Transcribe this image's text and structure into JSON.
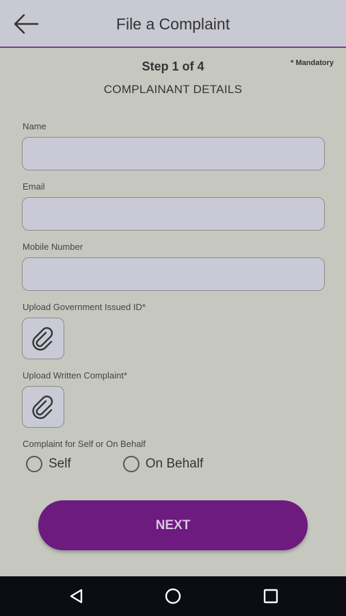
{
  "appbar": {
    "title": "File a Complaint",
    "back_icon": "arrow-left-icon"
  },
  "header": {
    "step": "Step 1 of 4",
    "mandatory_note": "* Mandatory",
    "section_title": "COMPLAINANT DETAILS"
  },
  "form": {
    "name": {
      "label": "Name",
      "value": ""
    },
    "email": {
      "label": "Email",
      "value": ""
    },
    "mobile": {
      "label": "Mobile Number",
      "value": ""
    },
    "upload_id": {
      "label": "Upload Government Issued ID*",
      "icon": "paperclip-icon"
    },
    "upload_complaint": {
      "label": "Upload Written Complaint*",
      "icon": "paperclip-icon"
    },
    "complaint_for": {
      "label": "Complaint for Self or On Behalf",
      "options": [
        "Self",
        "On Behalf"
      ],
      "selected": null
    }
  },
  "next_button": {
    "label": "NEXT"
  },
  "colors": {
    "primary": "#6d1b7e",
    "background": "#c6c8c0",
    "field": "#c9cad6"
  },
  "system_nav": {
    "back": "triangle-back-icon",
    "home": "circle-home-icon",
    "recents": "square-recents-icon"
  }
}
